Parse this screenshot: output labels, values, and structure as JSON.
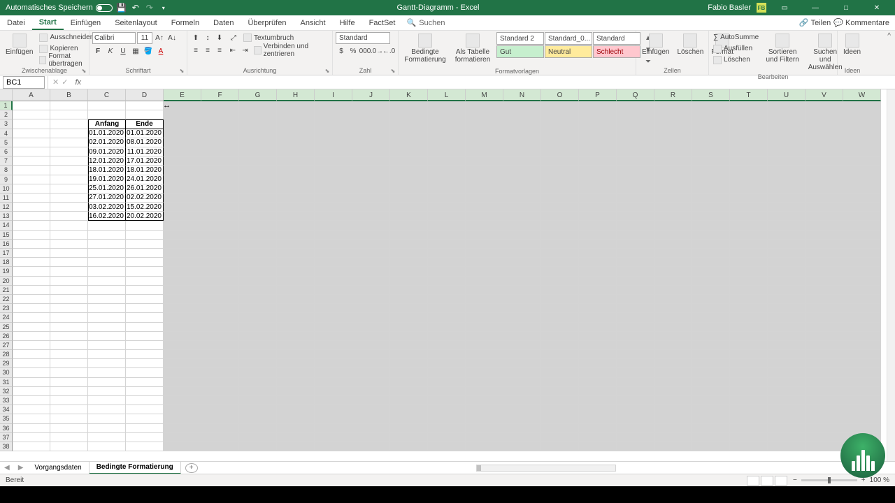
{
  "titlebar": {
    "autosave": "Automatisches Speichern",
    "doc_title": "Gantt-Diagramm - Excel",
    "user": "Fabio Basler",
    "user_initials": "FB"
  },
  "tabs": {
    "datei": "Datei",
    "start": "Start",
    "einfuegen": "Einfügen",
    "seitenlayout": "Seitenlayout",
    "formeln": "Formeln",
    "daten": "Daten",
    "ueberpruefen": "Überprüfen",
    "ansicht": "Ansicht",
    "hilfe": "Hilfe",
    "factset": "FactSet",
    "suchen": "Suchen",
    "teilen": "Teilen",
    "kommentare": "Kommentare"
  },
  "ribbon": {
    "zwischenablage": {
      "label": "Zwischenablage",
      "einfuegen": "Einfügen",
      "ausschneiden": "Ausschneiden",
      "kopieren": "Kopieren",
      "format_uebertragen": "Format übertragen"
    },
    "schriftart": {
      "label": "Schriftart",
      "font": "Calibri",
      "size": "11"
    },
    "ausrichtung": {
      "label": "Ausrichtung",
      "textumbruch": "Textumbruch",
      "verbinden": "Verbinden und zentrieren"
    },
    "zahl": {
      "label": "Zahl",
      "format": "Standard"
    },
    "formatvorlagen": {
      "label": "Formatvorlagen",
      "bedingte": "Bedingte Formatierung",
      "als_tabelle": "Als Tabelle formatieren",
      "std2": "Standard 2",
      "std0": "Standard_0...",
      "std": "Standard",
      "gut": "Gut",
      "neutral": "Neutral",
      "schlecht": "Schlecht"
    },
    "zellen": {
      "label": "Zellen",
      "einfuegen": "Einfügen",
      "loeschen": "Löschen",
      "format": "Format"
    },
    "bearbeiten": {
      "label": "Bearbeiten",
      "autosumme": "AutoSumme",
      "ausfuellen": "Ausfüllen",
      "loeschen": "Löschen",
      "sortieren": "Sortieren und Filtern",
      "suchen": "Suchen und Auswählen"
    },
    "ideen": {
      "label": "Ideen",
      "ideen": "Ideen"
    }
  },
  "formula_bar": {
    "name_box": "BC1"
  },
  "columns": [
    "A",
    "B",
    "C",
    "D",
    "E",
    "F",
    "G",
    "H",
    "I",
    "J",
    "K",
    "L",
    "M",
    "N",
    "O",
    "P",
    "Q",
    "R",
    "S",
    "T",
    "U",
    "V",
    "W"
  ],
  "table": {
    "headers": {
      "c": "Anfang",
      "d": "Ende"
    },
    "rows": [
      {
        "c": "01.01.2020",
        "d": "01.01.2020"
      },
      {
        "c": "02.01.2020",
        "d": "08.01.2020"
      },
      {
        "c": "09.01.2020",
        "d": "11.01.2020"
      },
      {
        "c": "12.01.2020",
        "d": "17.01.2020"
      },
      {
        "c": "18.01.2020",
        "d": "18.01.2020"
      },
      {
        "c": "19.01.2020",
        "d": "24.01.2020"
      },
      {
        "c": "25.01.2020",
        "d": "26.01.2020"
      },
      {
        "c": "27.01.2020",
        "d": "02.02.2020"
      },
      {
        "c": "03.02.2020",
        "d": "15.02.2020"
      },
      {
        "c": "16.02.2020",
        "d": "20.02.2020"
      }
    ]
  },
  "sheet_tabs": {
    "tab1": "Vorgangsdaten",
    "tab2": "Bedingte Formatierung"
  },
  "statusbar": {
    "ready": "Bereit",
    "zoom": "100 %"
  },
  "chart_data": {
    "type": "table",
    "title": "Gantt-Diagramm",
    "columns": [
      "Anfang",
      "Ende"
    ],
    "rows": [
      [
        "01.01.2020",
        "01.01.2020"
      ],
      [
        "02.01.2020",
        "08.01.2020"
      ],
      [
        "09.01.2020",
        "11.01.2020"
      ],
      [
        "12.01.2020",
        "17.01.2020"
      ],
      [
        "18.01.2020",
        "18.01.2020"
      ],
      [
        "19.01.2020",
        "24.01.2020"
      ],
      [
        "25.01.2020",
        "26.01.2020"
      ],
      [
        "27.01.2020",
        "02.02.2020"
      ],
      [
        "03.02.2020",
        "15.02.2020"
      ],
      [
        "16.02.2020",
        "20.02.2020"
      ]
    ]
  }
}
